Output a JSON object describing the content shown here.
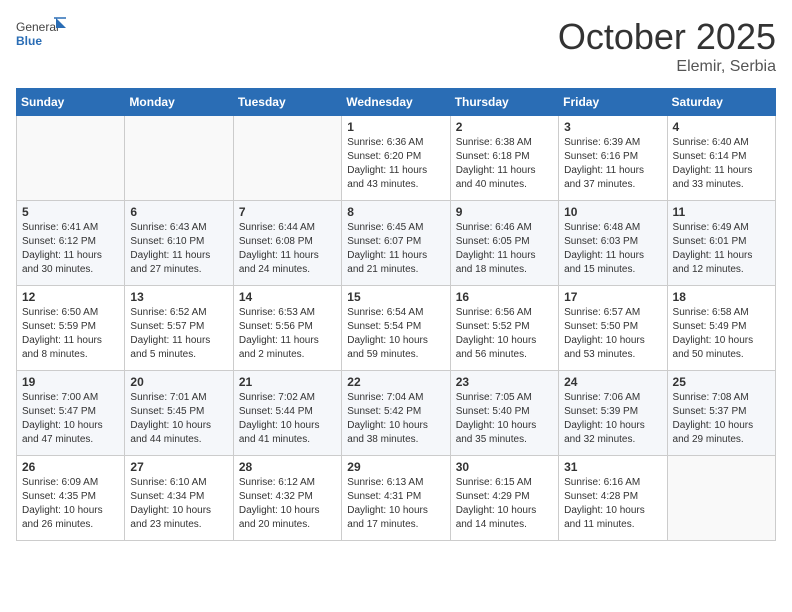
{
  "header": {
    "logo_general": "General",
    "logo_blue": "Blue",
    "month": "October 2025",
    "location": "Elemir, Serbia"
  },
  "weekdays": [
    "Sunday",
    "Monday",
    "Tuesday",
    "Wednesday",
    "Thursday",
    "Friday",
    "Saturday"
  ],
  "weeks": [
    [
      {
        "day": "",
        "text": ""
      },
      {
        "day": "",
        "text": ""
      },
      {
        "day": "",
        "text": ""
      },
      {
        "day": "1",
        "text": "Sunrise: 6:36 AM\nSunset: 6:20 PM\nDaylight: 11 hours\nand 43 minutes."
      },
      {
        "day": "2",
        "text": "Sunrise: 6:38 AM\nSunset: 6:18 PM\nDaylight: 11 hours\nand 40 minutes."
      },
      {
        "day": "3",
        "text": "Sunrise: 6:39 AM\nSunset: 6:16 PM\nDaylight: 11 hours\nand 37 minutes."
      },
      {
        "day": "4",
        "text": "Sunrise: 6:40 AM\nSunset: 6:14 PM\nDaylight: 11 hours\nand 33 minutes."
      }
    ],
    [
      {
        "day": "5",
        "text": "Sunrise: 6:41 AM\nSunset: 6:12 PM\nDaylight: 11 hours\nand 30 minutes."
      },
      {
        "day": "6",
        "text": "Sunrise: 6:43 AM\nSunset: 6:10 PM\nDaylight: 11 hours\nand 27 minutes."
      },
      {
        "day": "7",
        "text": "Sunrise: 6:44 AM\nSunset: 6:08 PM\nDaylight: 11 hours\nand 24 minutes."
      },
      {
        "day": "8",
        "text": "Sunrise: 6:45 AM\nSunset: 6:07 PM\nDaylight: 11 hours\nand 21 minutes."
      },
      {
        "day": "9",
        "text": "Sunrise: 6:46 AM\nSunset: 6:05 PM\nDaylight: 11 hours\nand 18 minutes."
      },
      {
        "day": "10",
        "text": "Sunrise: 6:48 AM\nSunset: 6:03 PM\nDaylight: 11 hours\nand 15 minutes."
      },
      {
        "day": "11",
        "text": "Sunrise: 6:49 AM\nSunset: 6:01 PM\nDaylight: 11 hours\nand 12 minutes."
      }
    ],
    [
      {
        "day": "12",
        "text": "Sunrise: 6:50 AM\nSunset: 5:59 PM\nDaylight: 11 hours\nand 8 minutes."
      },
      {
        "day": "13",
        "text": "Sunrise: 6:52 AM\nSunset: 5:57 PM\nDaylight: 11 hours\nand 5 minutes."
      },
      {
        "day": "14",
        "text": "Sunrise: 6:53 AM\nSunset: 5:56 PM\nDaylight: 11 hours\nand 2 minutes."
      },
      {
        "day": "15",
        "text": "Sunrise: 6:54 AM\nSunset: 5:54 PM\nDaylight: 10 hours\nand 59 minutes."
      },
      {
        "day": "16",
        "text": "Sunrise: 6:56 AM\nSunset: 5:52 PM\nDaylight: 10 hours\nand 56 minutes."
      },
      {
        "day": "17",
        "text": "Sunrise: 6:57 AM\nSunset: 5:50 PM\nDaylight: 10 hours\nand 53 minutes."
      },
      {
        "day": "18",
        "text": "Sunrise: 6:58 AM\nSunset: 5:49 PM\nDaylight: 10 hours\nand 50 minutes."
      }
    ],
    [
      {
        "day": "19",
        "text": "Sunrise: 7:00 AM\nSunset: 5:47 PM\nDaylight: 10 hours\nand 47 minutes."
      },
      {
        "day": "20",
        "text": "Sunrise: 7:01 AM\nSunset: 5:45 PM\nDaylight: 10 hours\nand 44 minutes."
      },
      {
        "day": "21",
        "text": "Sunrise: 7:02 AM\nSunset: 5:44 PM\nDaylight: 10 hours\nand 41 minutes."
      },
      {
        "day": "22",
        "text": "Sunrise: 7:04 AM\nSunset: 5:42 PM\nDaylight: 10 hours\nand 38 minutes."
      },
      {
        "day": "23",
        "text": "Sunrise: 7:05 AM\nSunset: 5:40 PM\nDaylight: 10 hours\nand 35 minutes."
      },
      {
        "day": "24",
        "text": "Sunrise: 7:06 AM\nSunset: 5:39 PM\nDaylight: 10 hours\nand 32 minutes."
      },
      {
        "day": "25",
        "text": "Sunrise: 7:08 AM\nSunset: 5:37 PM\nDaylight: 10 hours\nand 29 minutes."
      }
    ],
    [
      {
        "day": "26",
        "text": "Sunrise: 6:09 AM\nSunset: 4:35 PM\nDaylight: 10 hours\nand 26 minutes."
      },
      {
        "day": "27",
        "text": "Sunrise: 6:10 AM\nSunset: 4:34 PM\nDaylight: 10 hours\nand 23 minutes."
      },
      {
        "day": "28",
        "text": "Sunrise: 6:12 AM\nSunset: 4:32 PM\nDaylight: 10 hours\nand 20 minutes."
      },
      {
        "day": "29",
        "text": "Sunrise: 6:13 AM\nSunset: 4:31 PM\nDaylight: 10 hours\nand 17 minutes."
      },
      {
        "day": "30",
        "text": "Sunrise: 6:15 AM\nSunset: 4:29 PM\nDaylight: 10 hours\nand 14 minutes."
      },
      {
        "day": "31",
        "text": "Sunrise: 6:16 AM\nSunset: 4:28 PM\nDaylight: 10 hours\nand 11 minutes."
      },
      {
        "day": "",
        "text": ""
      }
    ]
  ]
}
